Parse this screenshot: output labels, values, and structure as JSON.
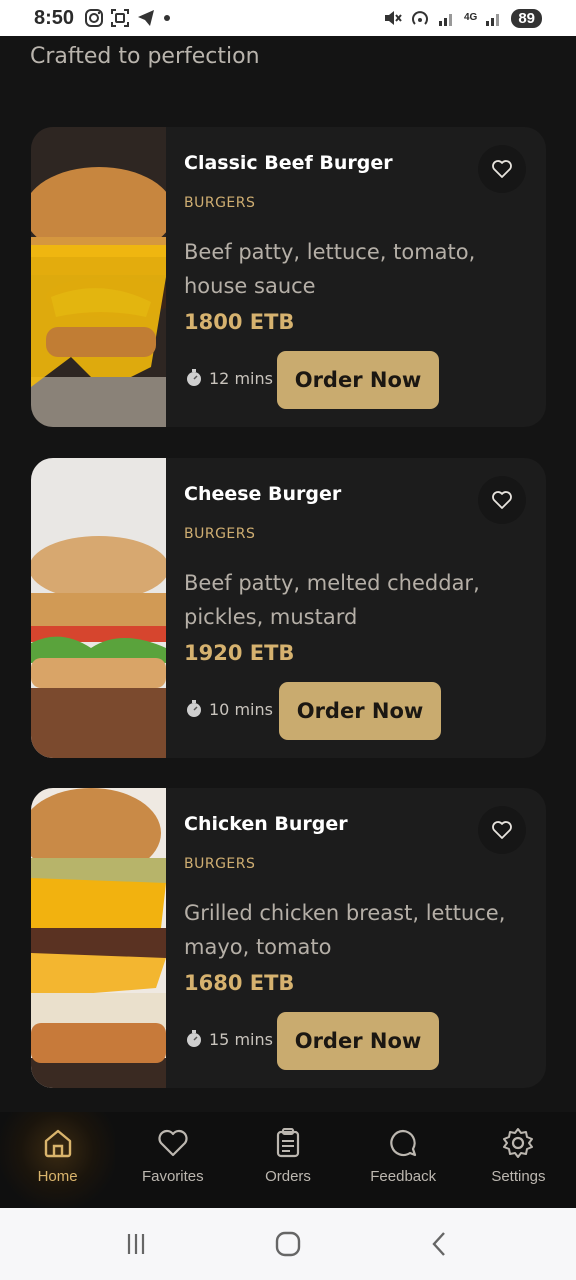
{
  "status_bar": {
    "time": "8:50",
    "battery": "89",
    "network": "4G"
  },
  "subtitle": "Crafted to perfection",
  "menu_items": [
    {
      "title": "Classic Beef Burger",
      "category": "BURGERS",
      "description": "Beef patty, lettuce, tomato, house sauce",
      "price": "1800 ETB",
      "time": "12 mins",
      "button": "Order Now"
    },
    {
      "title": "Cheese Burger",
      "category": "BURGERS",
      "description": "Beef patty, melted cheddar, pickles, mustard",
      "price": "1920 ETB",
      "time": "10 mins",
      "button": "Order Now"
    },
    {
      "title": "Chicken Burger",
      "category": "BURGERS",
      "description": "Grilled chicken breast, lettuce, mayo, tomato",
      "price": "1680 ETB",
      "time": "15 mins",
      "button": "Order Now"
    }
  ],
  "nav": [
    {
      "label": "Home",
      "icon": "home-icon",
      "active": true
    },
    {
      "label": "Favorites",
      "icon": "heart-icon"
    },
    {
      "label": "Orders",
      "icon": "clipboard-icon"
    },
    {
      "label": "Feedback",
      "icon": "chat-bubble-icon"
    },
    {
      "label": "Settings",
      "icon": "gear-icon"
    }
  ],
  "colors": {
    "background": "#141414",
    "card": "#1c1c1c",
    "accent": "#c9ab6f",
    "price": "#d6b26f",
    "category": "#cfae72"
  }
}
